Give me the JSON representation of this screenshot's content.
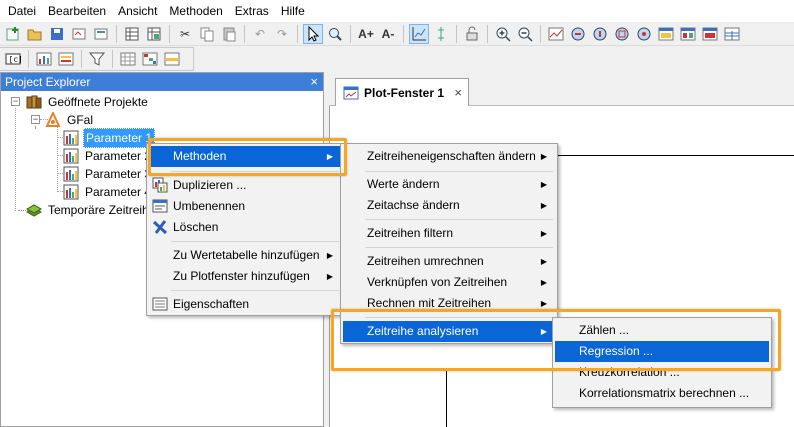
{
  "menubar": [
    "Datei",
    "Bearbeiten",
    "Ansicht",
    "Methoden",
    "Extras",
    "Hilfe"
  ],
  "explorer": {
    "title": "Project Explorer",
    "close": "×",
    "root": "Geöffnete Projekte",
    "project": "GFal",
    "items": [
      "Parameter 1",
      "Parameter 2",
      "Parameter 3",
      "Parameter 4"
    ],
    "temp": "Temporäre Zeitreihen"
  },
  "plot_tab": {
    "label": "Plot-Fenster 1",
    "close": "×"
  },
  "context_menu": {
    "methoden": "Methoden",
    "duplizieren": "Duplizieren ...",
    "umbenennen": "Umbenennen",
    "loeschen": "Löschen",
    "wertetabelle": "Zu Wertetabelle hinzufügen",
    "plotfenster": "Zu Plotfenster hinzufügen",
    "eigenschaften": "Eigenschaften"
  },
  "methoden_menu": {
    "eigenschaften": "Zeitreiheneigenschaften ändern",
    "werte": "Werte ändern",
    "zeitachse": "Zeitachse ändern",
    "filtern": "Zeitreihen filtern",
    "umrechnen": "Zeitreihen umrechnen",
    "verknuepfen": "Verknüpfen von Zeitreihen",
    "rechnen": "Rechnen mit Zeitreihen",
    "analysieren": "Zeitreihe analysieren"
  },
  "analyse_menu": {
    "zaehlen": "Zählen ...",
    "regression": "Regression ...",
    "kreuzkorrelation": "Kreuzkorrelation ...",
    "korrelationsmatrix": "Korrelationsmatrix berechnen ..."
  },
  "colors": {
    "highlight": "#0a66d6",
    "callout": "#f5a623",
    "explorer_header": "#3d7fd8"
  }
}
